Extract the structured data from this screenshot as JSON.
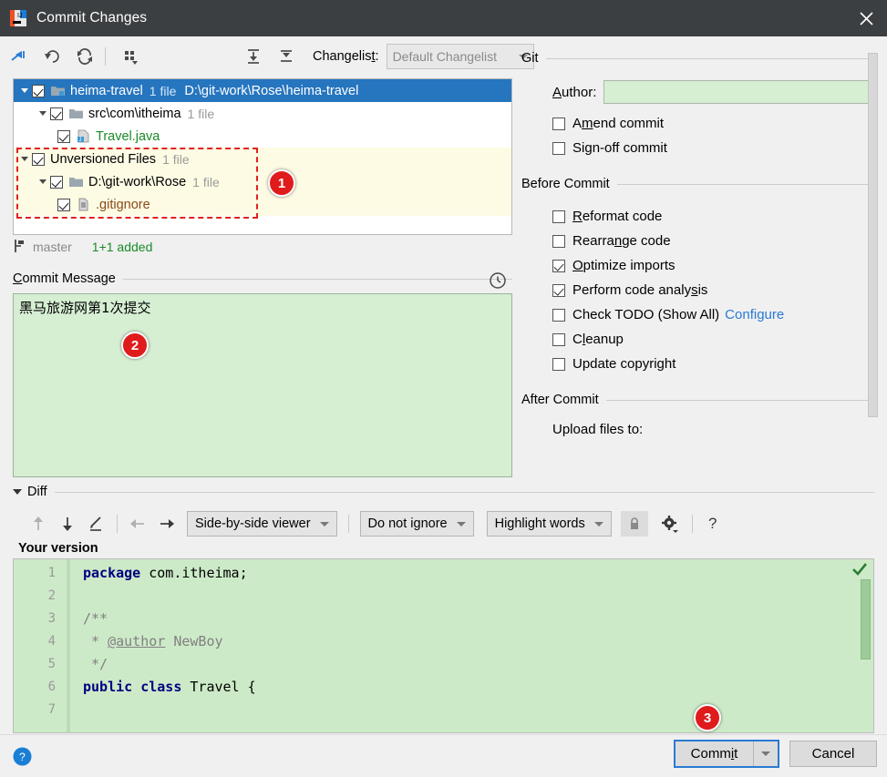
{
  "window": {
    "title": "Commit Changes",
    "app_icon": "intellij-idea-icon",
    "close_icon": "close-icon",
    "titlebar_bg": "#3c3f41"
  },
  "toolbar": {
    "icons": [
      {
        "name": "collapse-to-selection-icon",
        "label": "Move to Another Changelist"
      },
      {
        "name": "revert-icon",
        "label": "Revert"
      },
      {
        "name": "refresh-icon",
        "label": "Refresh"
      },
      {
        "name": "group-by-icon",
        "label": "Group By"
      },
      {
        "name": "expand-all-icon",
        "label": "Expand All"
      },
      {
        "name": "collapse-all-icon",
        "label": "Collapse All"
      }
    ],
    "changelist_label": "Changelist:",
    "changelist_mnemonic": "t",
    "changelist_value": "Default Changelist"
  },
  "tree": {
    "rows": [
      {
        "id": "heima-travel",
        "indent": 0,
        "expanded": true,
        "checked": true,
        "icon": "module-folder-icon",
        "label": "heima-travel",
        "count": "1 file",
        "path": "D:\\git-work\\Rose\\heima-travel",
        "selected": true,
        "highlight": false,
        "label_color": "#ffffff"
      },
      {
        "id": "src-com-itheima",
        "indent": 1,
        "expanded": true,
        "checked": true,
        "icon": "folder-icon",
        "label": "src\\com\\itheima",
        "count": "1 file",
        "path": "",
        "selected": false,
        "highlight": false,
        "label_color": "#000000"
      },
      {
        "id": "travel-java",
        "indent": 2,
        "expanded": null,
        "checked": true,
        "icon": "java-file-icon",
        "label": "Travel.java",
        "count": "",
        "path": "",
        "selected": false,
        "highlight": false,
        "label_color": "#1a8a28"
      },
      {
        "id": "unversioned-files",
        "indent": 0,
        "expanded": true,
        "checked": true,
        "icon": "",
        "label": "Unversioned Files",
        "count": "1 file",
        "path": "",
        "selected": false,
        "highlight": true,
        "label_color": "#000000"
      },
      {
        "id": "rose-folder",
        "indent": 1,
        "expanded": true,
        "checked": true,
        "icon": "folder-icon",
        "label": "D:\\git-work\\Rose",
        "count": "1 file",
        "path": "",
        "selected": false,
        "highlight": true,
        "label_color": "#000000"
      },
      {
        "id": "gitignore",
        "indent": 2,
        "expanded": null,
        "checked": true,
        "icon": "text-file-icon",
        "label": ".gitignore",
        "count": "",
        "path": "",
        "selected": false,
        "highlight": true,
        "label_color": "#8a4a1a"
      }
    ]
  },
  "branch_bar": {
    "icon": "git-branch-icon",
    "branch": "master",
    "stats": "1+1 added"
  },
  "commit_message": {
    "section_label": "Commit Message",
    "section_mnemonic": "C",
    "value": "黑马旅游网第1次提交",
    "history_icon": "clock-history-icon"
  },
  "right_panel": {
    "git_section": "Git",
    "author_label": "Author:",
    "author_mnemonic": "A",
    "author_value": "",
    "git_checkboxes": [
      {
        "name": "amend-commit",
        "label_pre": "A",
        "label_mn": "m",
        "label_post": "end commit",
        "checked": false
      },
      {
        "name": "sign-off-commit",
        "label_pre": "Si",
        "label_mn": "g",
        "label_post": "n-off commit",
        "checked": false
      }
    ],
    "before_commit_section": "Before Commit",
    "before_commit_checkboxes": [
      {
        "name": "reformat-code",
        "label_pre": "",
        "label_mn": "R",
        "label_post": "eformat code",
        "checked": false,
        "link": ""
      },
      {
        "name": "rearrange-code",
        "label_pre": "Rearra",
        "label_mn": "n",
        "label_post": "ge code",
        "checked": false,
        "link": ""
      },
      {
        "name": "optimize-imports",
        "label_pre": "",
        "label_mn": "O",
        "label_post": "ptimize imports",
        "checked": true,
        "link": ""
      },
      {
        "name": "perform-code-analysis",
        "label_pre": "Perform code analy",
        "label_mn": "s",
        "label_post": "is",
        "checked": true,
        "link": ""
      },
      {
        "name": "check-todo",
        "label_pre": "Check TODO (Show All)",
        "label_mn": "",
        "label_post": "",
        "checked": false,
        "link": "Configure"
      },
      {
        "name": "cleanup",
        "label_pre": "C",
        "label_mn": "l",
        "label_post": "eanup",
        "checked": false,
        "link": ""
      },
      {
        "name": "update-copyright",
        "label_pre": "Update copyright",
        "label_mn": "",
        "label_post": "",
        "checked": false,
        "link": ""
      }
    ],
    "after_commit_section": "After Commit",
    "upload_files_label": "Upload files to:"
  },
  "diff": {
    "section_label": "Diff",
    "toolbar_icons": [
      {
        "name": "previous-difference-icon"
      },
      {
        "name": "next-difference-icon"
      },
      {
        "name": "edit-source-icon"
      },
      {
        "name": "apply-left-icon"
      },
      {
        "name": "apply-right-icon"
      }
    ],
    "viewer_mode": "Side-by-side viewer",
    "ignore_mode": "Do not ignore",
    "highlight_mode": "Highlight words",
    "lock_icon": "lock-icon",
    "settings_icon": "gear-icon",
    "help_icon": "question-mark-icon",
    "pane_title": "Your version",
    "line_numbers": [
      "1",
      "2",
      "3",
      "4",
      "5",
      "6",
      "7"
    ],
    "code_lines": [
      [
        {
          "t": "package ",
          "c": "kw"
        },
        {
          "t": "com.itheima;",
          "c": ""
        }
      ],
      [],
      [
        {
          "t": "/**",
          "c": "cm"
        }
      ],
      [
        {
          "t": " * ",
          "c": "cm"
        },
        {
          "t": "@author",
          "c": "tag"
        },
        {
          "t": " NewBoy",
          "c": "cm"
        }
      ],
      [
        {
          "t": " */",
          "c": "cm"
        }
      ],
      [
        {
          "t": "public class ",
          "c": "kw"
        },
        {
          "t": "Travel {",
          "c": ""
        }
      ],
      []
    ],
    "status_icon": "checkmark-ok-icon"
  },
  "footer": {
    "help_icon": "help-circle-icon",
    "commit_pre": "Comm",
    "commit_mn": "i",
    "commit_post": "t",
    "commit_dropdown_icon": "chevron-down-icon",
    "cancel_label": "Cancel"
  },
  "badges": [
    {
      "name": "annotation-badge-1",
      "value": "1"
    },
    {
      "name": "annotation-badge-2",
      "value": "2"
    },
    {
      "name": "annotation-badge-3",
      "value": "3"
    }
  ],
  "colors": {
    "selection_blue": "#2675bf",
    "accent_blue": "#2a7ad4",
    "added_green": "#1a8a28",
    "diff_bg": "#cdeac8",
    "highlight_yellow": "#fdfbe4",
    "badge_red": "#e01b1b"
  }
}
